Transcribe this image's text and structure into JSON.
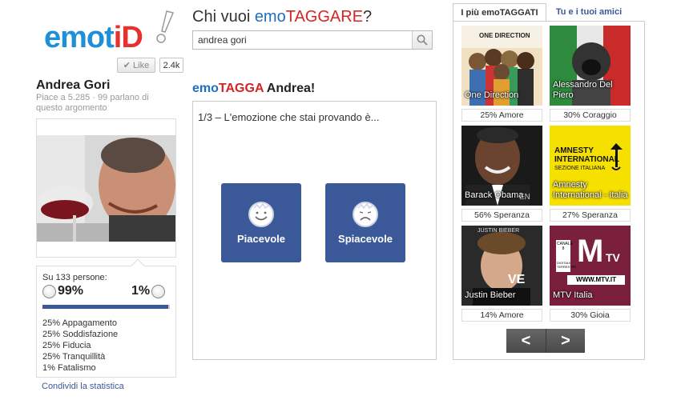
{
  "logo": {
    "part1": "emot",
    "part2": "iD"
  },
  "like": {
    "label": "Like",
    "count": "2.4k"
  },
  "person": {
    "name": "Andrea Gori",
    "subtitle": "Piace a 5.285 · 99 parlano di questo argomento"
  },
  "stats": {
    "header": "Su 133 persone:",
    "positive_pct": "99%",
    "negative_pct": "1%",
    "positive_fraction": 0.99,
    "items": [
      "25% Appagamento",
      "25% Soddisfazione",
      "25% Fiducia",
      "25% Tranquillità",
      "1% Fatalismo"
    ],
    "share_label": "Condividi la statistica"
  },
  "question": {
    "prefix": "Chi vuoi ",
    "emo": "emo",
    "tag": "TAGGARE",
    "suffix": "?"
  },
  "search": {
    "value": "andrea gori"
  },
  "tag_title": {
    "emo": "emo",
    "tagga": "TAGGA",
    "name": " Andrea!"
  },
  "step_text": "1/3 – L'emozione che stai provando è...",
  "buttons": {
    "positive": "Piacevole",
    "negative": "Spiacevole"
  },
  "tabs": {
    "top": "I più emoTAGGATI",
    "friends": "Tu e i tuoi amici"
  },
  "tiles": [
    {
      "label": "One Direction",
      "caption": "25% Amore"
    },
    {
      "label": "Alessandro Del Piero",
      "caption": "30% Coraggio"
    },
    {
      "label": "Barack Obama",
      "caption": "56% Speranza"
    },
    {
      "label": "Amnesty International - Italia",
      "caption": "27% Speranza"
    },
    {
      "label": "Justin Bieber",
      "caption": "14% Amore"
    },
    {
      "label": "MTV Italia",
      "caption": "30% Gioia"
    }
  ],
  "tile_art": {
    "one_direction": "ONE DIRECTION",
    "amnesty": "AMNESTY INTERNATIONAL",
    "amnesty_sub": "SEZIONE ITALIANA",
    "mtv_channel": "CANALE 8",
    "mtv_sub": "DIGITALE TERRESTRE",
    "mtv_logo": "M",
    "mtv_tv": "TV",
    "mtv_url": "WWW.MTV.IT",
    "bieber": "JUSTIN BIEBER"
  },
  "nav": {
    "prev": "<",
    "next": ">"
  },
  "colors": {
    "brand_blue": "#3b5998",
    "logo_blue": "#1e90d8",
    "logo_red": "#e8312f",
    "tag_red": "#d42525"
  }
}
